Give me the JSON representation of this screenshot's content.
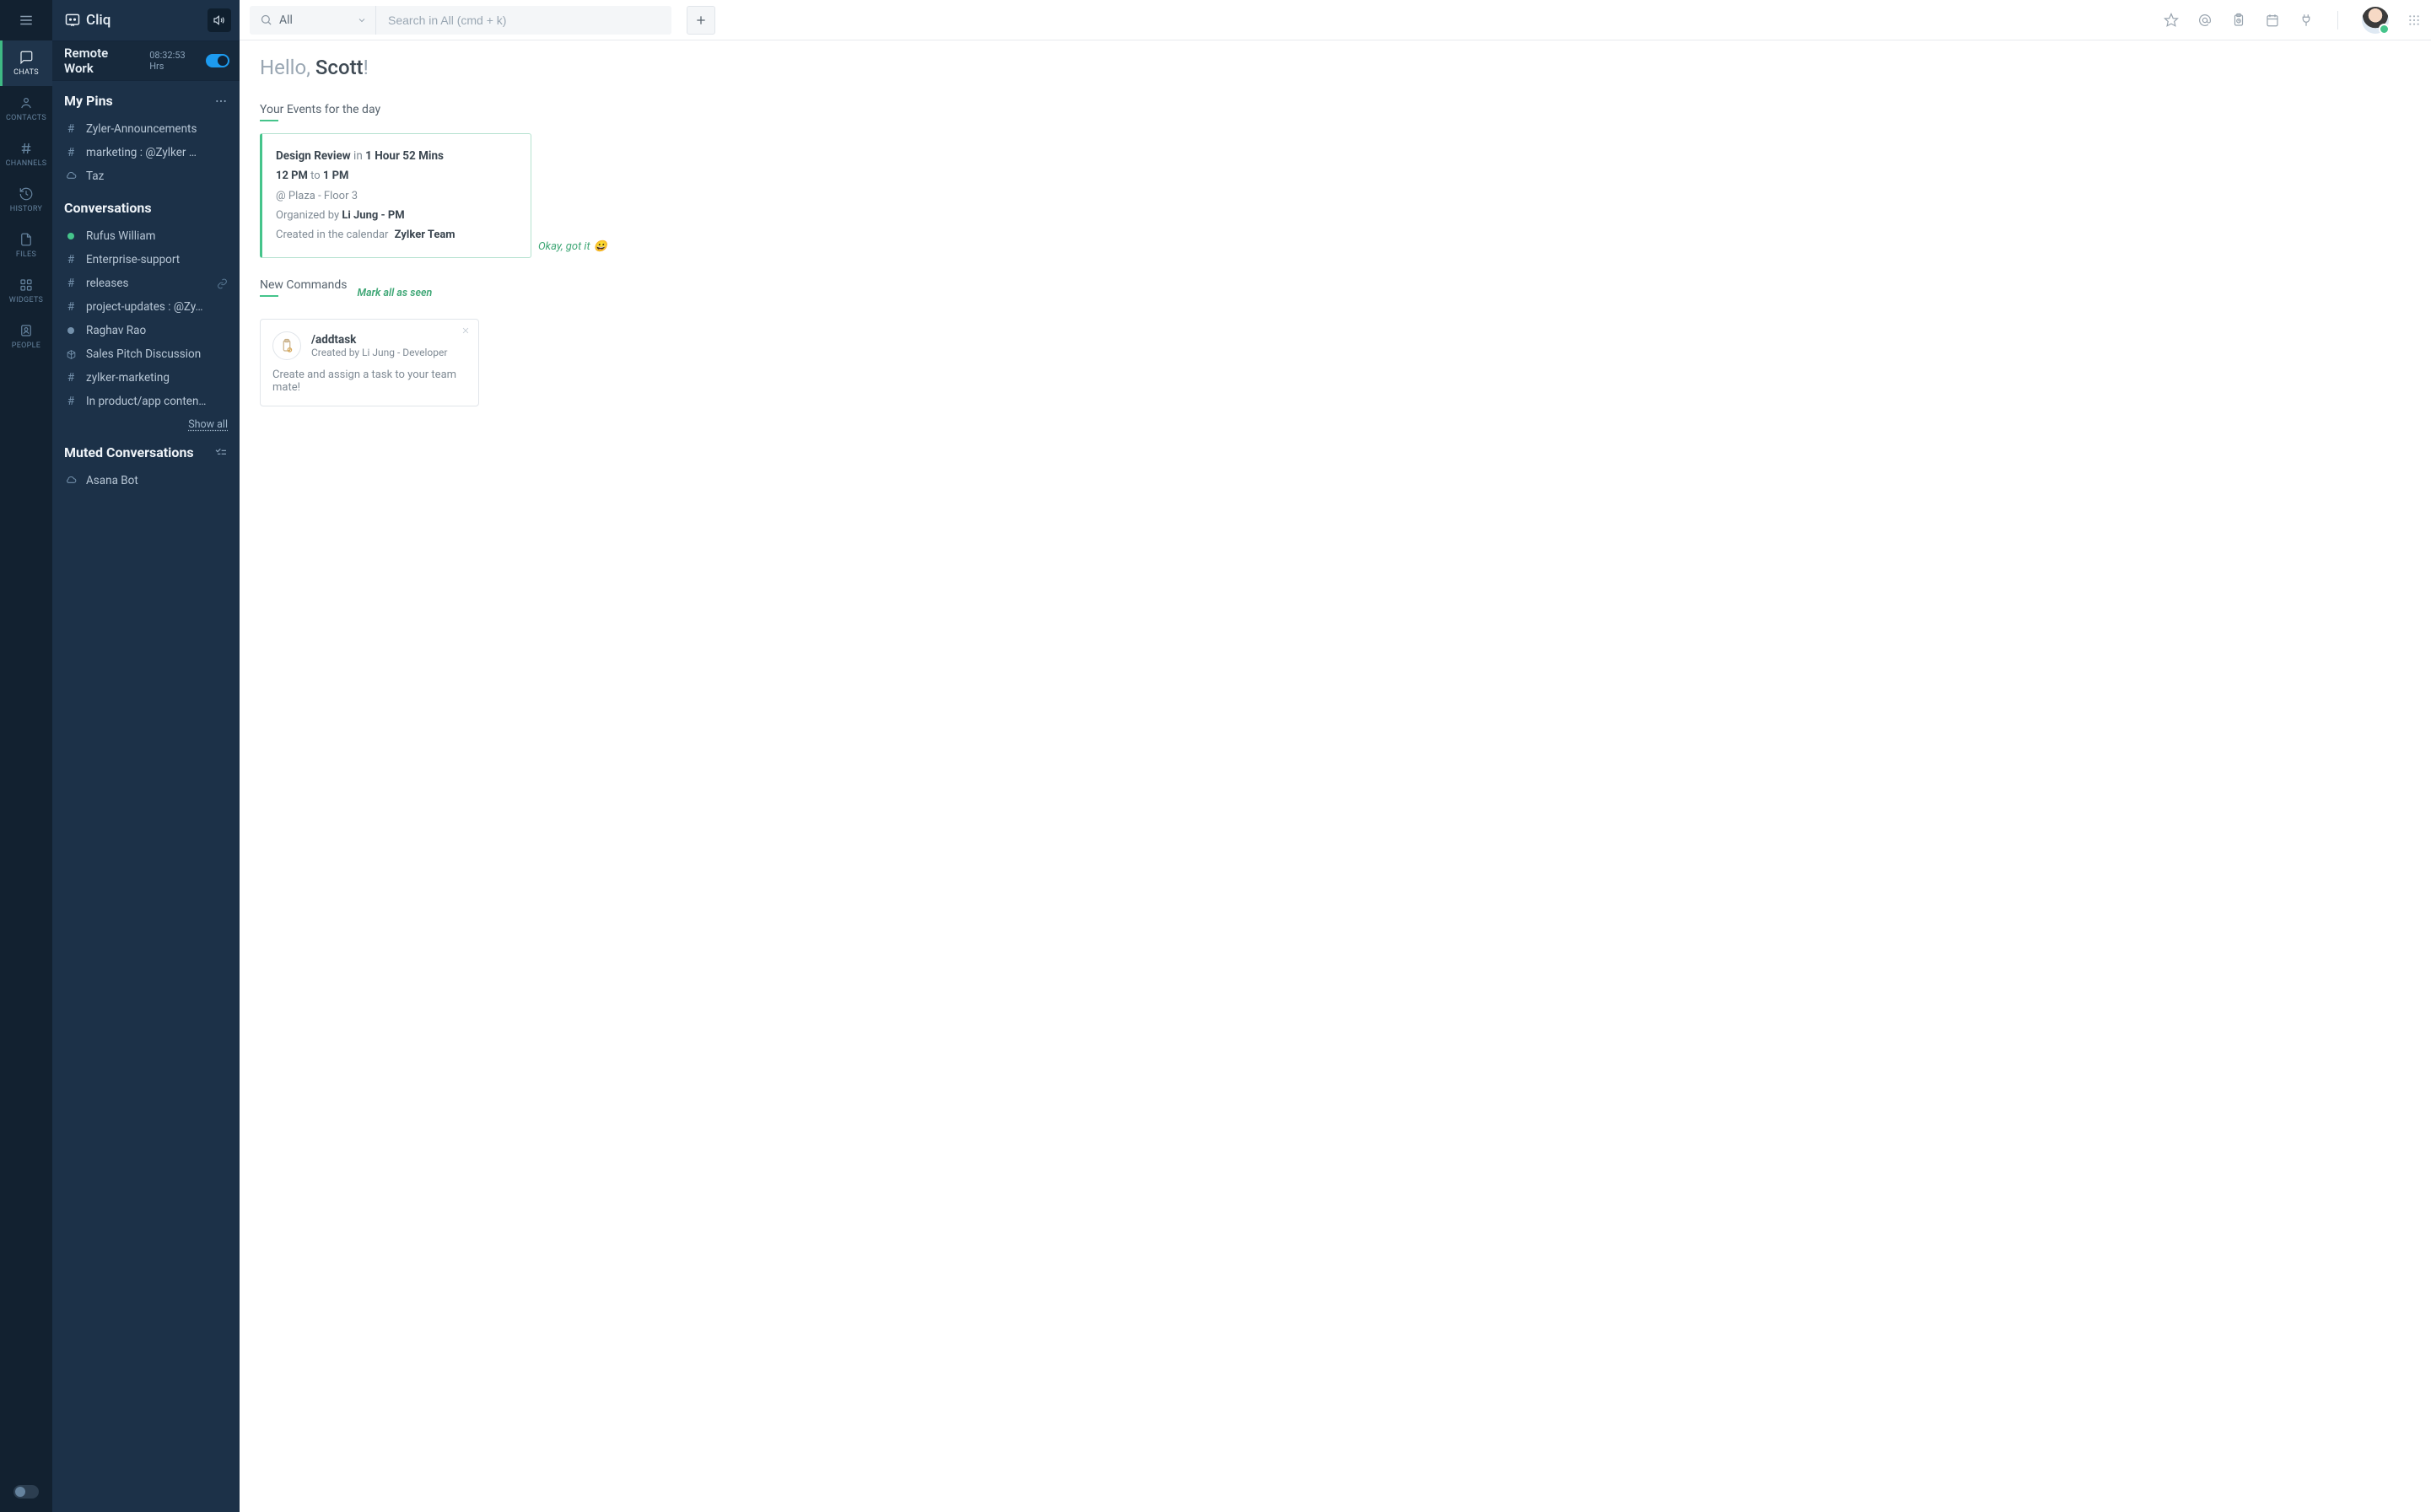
{
  "brand": {
    "name": "Cliq"
  },
  "remote": {
    "title": "Remote Work",
    "time": "08:32:53 Hrs"
  },
  "rail": {
    "items": [
      {
        "id": "chats",
        "label": "CHATS"
      },
      {
        "id": "contacts",
        "label": "CONTACTS"
      },
      {
        "id": "channels",
        "label": "CHANNELS"
      },
      {
        "id": "history",
        "label": "HISTORY"
      },
      {
        "id": "files",
        "label": "FILES"
      },
      {
        "id": "widgets",
        "label": "WIDGETS"
      },
      {
        "id": "people",
        "label": "PEOPLE"
      }
    ]
  },
  "pins": {
    "title": "My Pins",
    "items": [
      {
        "icon": "hash",
        "label": "Zyler-Announcements"
      },
      {
        "icon": "hash",
        "label": "marketing : @Zylker …"
      },
      {
        "icon": "cloud",
        "label": "Taz"
      }
    ]
  },
  "conversations": {
    "title": "Conversations",
    "items": [
      {
        "icon": "dot-online",
        "label": "Rufus William"
      },
      {
        "icon": "hash",
        "label": "Enterprise-support"
      },
      {
        "icon": "hash",
        "label": "releases",
        "trailing": "link"
      },
      {
        "icon": "hash",
        "label": "project-updates : @Zy…"
      },
      {
        "icon": "dot-offline",
        "label": "Raghav Rao"
      },
      {
        "icon": "cube",
        "label": "Sales Pitch Discussion"
      },
      {
        "icon": "hash",
        "label": "zylker-marketing"
      },
      {
        "icon": "hash",
        "label": "In product/app conten…"
      }
    ],
    "show_all": "Show all"
  },
  "muted": {
    "title": "Muted Conversations",
    "items": [
      {
        "icon": "cloud",
        "label": "Asana Bot"
      }
    ]
  },
  "search": {
    "scope": "All",
    "placeholder": "Search in All (cmd + k)"
  },
  "hello": {
    "prefix": "Hello, ",
    "name": "Scott",
    "suffix": "!"
  },
  "events": {
    "heading": "Your Events for the day",
    "card": {
      "title": "Design Review",
      "in_label": " in ",
      "in_time": "1 Hour 52 Mins",
      "start": "12 PM",
      "to": " to ",
      "end": "1 PM",
      "location": "@ Plaza - Floor 3",
      "org_label": "Organized by ",
      "organizer": "Li Jung - PM",
      "cal_label": "Created in the calendar",
      "calendar": "Zylker Team"
    },
    "ok": "Okay, got it",
    "ok_emoji": "😀"
  },
  "commands": {
    "heading": "New Commands",
    "mark_all": "Mark all as seen",
    "card": {
      "name": "/addtask",
      "sub": "Created by Li Jung - Developer",
      "desc": "Create and assign a task to your team mate!"
    }
  }
}
